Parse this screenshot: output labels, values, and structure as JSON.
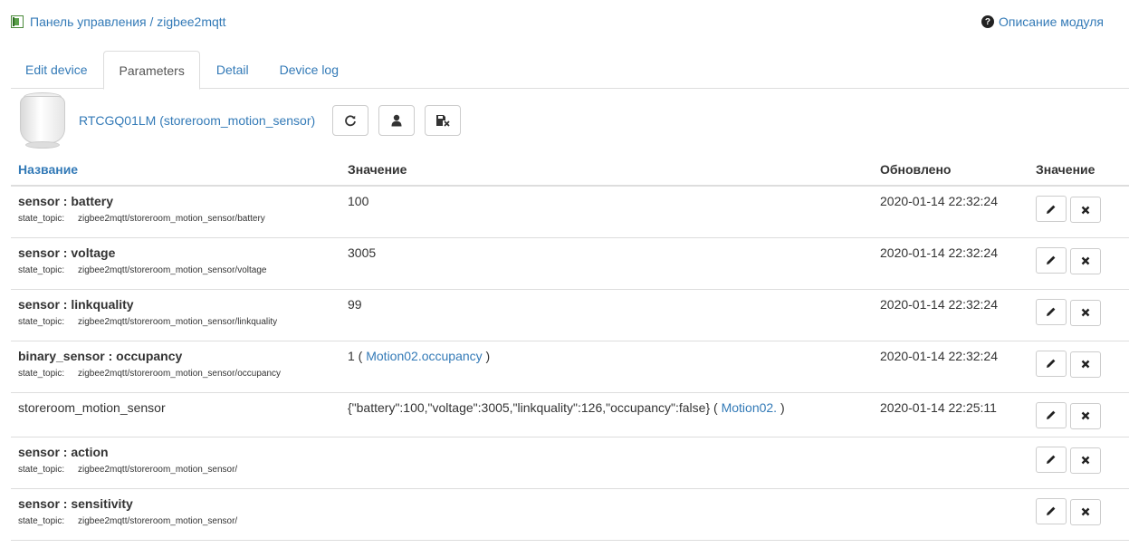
{
  "breadcrumb": {
    "text": "Панель управления / zigbee2mqtt",
    "icon": "app-module-icon"
  },
  "help_link": {
    "label": "Описание модуля",
    "icon": "question-circle-icon"
  },
  "tabs": [
    {
      "label": "Edit device",
      "active": false
    },
    {
      "label": "Parameters",
      "active": true
    },
    {
      "label": "Detail",
      "active": false
    },
    {
      "label": "Device log",
      "active": false
    }
  ],
  "device": {
    "title": "RTCGQ01LM (storeroom_motion_sensor)",
    "buttons": [
      "refresh-icon",
      "user-icon",
      "save-remove-icon"
    ]
  },
  "table": {
    "headers": [
      "Название",
      "Значение",
      "Обновлено",
      "Значение"
    ],
    "topic_label": "state_topic:",
    "rows": [
      {
        "name": "sensor :  battery",
        "topic": "zigbee2mqtt/storeroom_motion_sensor/battery",
        "value": "100",
        "updated": "2020-01-14 22:32:24"
      },
      {
        "name": "sensor :  voltage",
        "topic": "zigbee2mqtt/storeroom_motion_sensor/voltage",
        "value": "3005",
        "updated": "2020-01-14 22:32:24"
      },
      {
        "name": "sensor :  linkquality",
        "topic": "zigbee2mqtt/storeroom_motion_sensor/linkquality",
        "value": "99",
        "updated": "2020-01-14 22:32:24"
      },
      {
        "name": "binary_sensor :  occupancy",
        "topic": "zigbee2mqtt/storeroom_motion_sensor/occupancy",
        "value": "1 (",
        "value_link": "Motion02.occupancy",
        "value_suffix": ")",
        "updated": "2020-01-14 22:32:24"
      },
      {
        "name": "storeroom_motion_sensor",
        "topic": "",
        "value": "{\"battery\":100,\"voltage\":3005,\"linkquality\":126,\"occupancy\":false} (",
        "value_link": "Motion02.",
        "value_suffix": ")",
        "updated": "2020-01-14 22:25:11"
      },
      {
        "name": "sensor :  action",
        "topic": "zigbee2mqtt/storeroom_motion_sensor/",
        "value": "",
        "updated": ""
      },
      {
        "name": "sensor :  sensitivity",
        "topic": "zigbee2mqtt/storeroom_motion_sensor/",
        "value": "",
        "updated": ""
      }
    ]
  },
  "row_actions": {
    "edit_icon": "pencil-icon",
    "delete_icon": "close-icon"
  }
}
